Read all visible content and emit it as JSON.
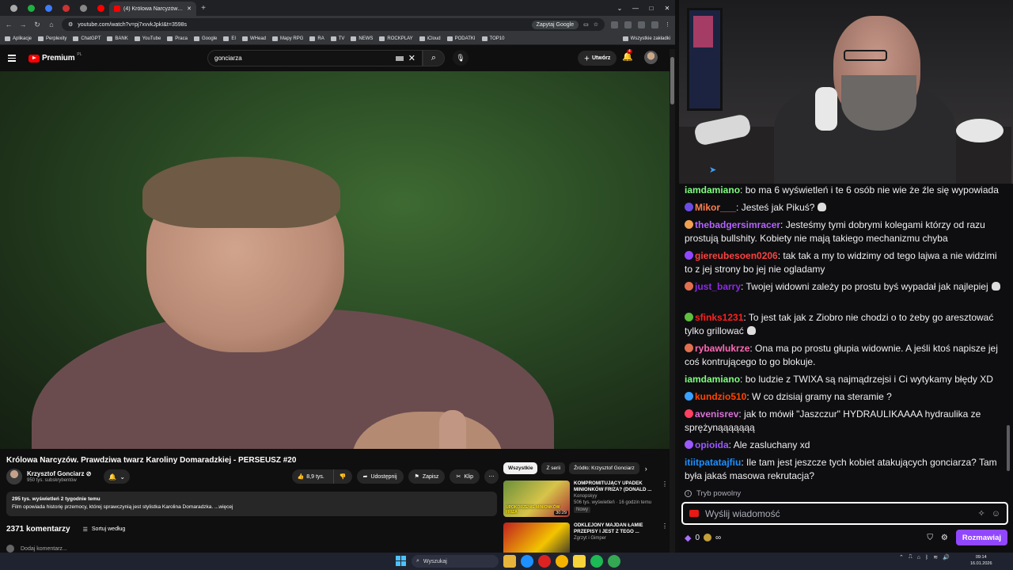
{
  "browser": {
    "active_tab_title": "(4) Królowa Narcyzów. Prawdziwa...",
    "new_tab": "+",
    "url": "youtube.com/watch?v=pj7xvvkJpkI&t=3598s",
    "ask_google": "Zapytaj Google",
    "bookmarks": [
      "Aplikacje",
      "Perplexity",
      "ChatGPT",
      "BANK",
      "YouTube",
      "Praca",
      "Google",
      "EI",
      "WHead",
      "Mapy RPG",
      "RA",
      "TV",
      "NEWS",
      "ROCKPLAY",
      "iCloud",
      "PODATKI",
      "TOP10"
    ],
    "bookmarks_right": "Wszystkie zakładki"
  },
  "youtube": {
    "brand": "Premium",
    "brand_cc": "PL",
    "search_value": "gonciarza",
    "create_label": "Utwórz",
    "notif_count": "4",
    "video_title": "Królowa Narcyzów. Prawdziwa twarz Karoliny Domaradzkiej - PERSEUSZ #20",
    "channel_name": "Krzysztof Gonciarz",
    "channel_verified": "⊘",
    "subscribers": "950 tys. subskrybentów",
    "likes": "8,9 tys.",
    "share": "Udostępnij",
    "save": "Zapisz",
    "clip": "Klip",
    "desc_stats": "295 tys. wyświetleń  2 tygodnie temu",
    "desc_text": "Film opowiada historię przemocy, której sprawczynią jest stylistka Karolina Domaradzka. ...więcej",
    "comments_count": "2371 komentarzy",
    "sort_label": "Sortuj według",
    "add_comment": "Dodaj komentarz...",
    "chips": [
      "Wszystkie",
      "Z serii",
      "Źródło: Krzysztof Gonciarz"
    ],
    "related": [
      {
        "title": "KOMPROMITUJĄCY UPADEK MINIONKÓW FRIZA? (DONALD ...",
        "channel": "Konopskyy",
        "meta": "506 tys. wyświetleń · 16 godzin temu",
        "badge": "Nowy",
        "duration": "30:29",
        "thumb_caption": "UPOKORZENIE MINIONKÓW FRIZA"
      },
      {
        "title": "ODKLEJONY MAJDAN ŁAMIE PRZEPISY I JEST Z TEGO ...",
        "channel": "Zgrzyt i Gimper",
        "meta": "",
        "badge": "",
        "duration": "",
        "thumb_caption": ""
      }
    ]
  },
  "chat": {
    "messages": [
      {
        "user": "iamdamiano",
        "color": "#7fff7f",
        "text": "bo ma 6 wyświetleń i te 6 osób nie wie że źle się wypowiada",
        "badge": "",
        "skull": false
      },
      {
        "user": "Mikor___",
        "color": "#ff7f50",
        "text": "Jesteś jak Pikuś?",
        "badge": "#6b4de6",
        "skull": true
      },
      {
        "user": "thebadgersimracer",
        "color": "#b463ff",
        "text": "Jesteśmy tymi dobrymi kolegami którzy od razu prostują bullshity. Kobiety nie mają takiego mechanizmu chyba",
        "badge": "#f0a050",
        "skull": false
      },
      {
        "user": "giereubesoen0206",
        "color": "#ff4040",
        "text": "tak tak a my to widzimy od tego lajwa a nie widzimi to z jej strony bo jej nie ogladamy",
        "badge": "#9147ff",
        "skull": false
      },
      {
        "user": "just_barry",
        "color": "#8a2be2",
        "text": "Twojej widowni zależy po prostu byś wypadał jak najlepiej",
        "badge": "#e07050",
        "skull": true
      },
      {
        "user": "sfinks1231",
        "color": "#ff2020",
        "text": "To jest tak jak z Ziobro nie chodzi o to żeby go aresztować tylko grillować",
        "badge": "#5fbf3f",
        "skull": true
      },
      {
        "user": "rybawlukrze",
        "color": "#ff69b4",
        "text": "Ona ma po prostu głupia widownie. A jeśli ktoś napisze jej coś kontrującego to go blokuje.",
        "badge": "#e07050",
        "skull": false
      },
      {
        "user": "iamdamiano",
        "color": "#7fff7f",
        "text": "bo ludzie z TWIXA są najmądrzejsi i Ci wytykamy błędy XD",
        "badge": "",
        "skull": false
      },
      {
        "user": "kundzio510",
        "color": "#ff4500",
        "text": "W co dzisiaj gramy na steramie ?",
        "badge": "#3aa1ff",
        "skull": false
      },
      {
        "user": "avenisrev",
        "color": "#da70d6",
        "text": "jak to mówił \"Jaszczur\" HYDRAULIKAAAA hydraulika ze sprężynąąąąąąą",
        "badge": "#ff4060",
        "skull": false
      },
      {
        "user": "opioida",
        "color": "#9b59ff",
        "text": "Ale zasluchany xd",
        "badge": "#9b59ff",
        "skull": false
      },
      {
        "user": "itiitpatatajfiu",
        "color": "#1e90ff",
        "text": "Ile tam jest jeszcze tych kobiet atakujących gonciarza? Tam była jakaś masowa rekrutacja?",
        "badge": "",
        "skull": false
      }
    ],
    "slow_mode": "Tryb powolny",
    "input_placeholder": "Wyślij wiadomość",
    "bits": "0",
    "points": "∞",
    "send_label": "Rozmawiaj"
  },
  "taskbar": {
    "search_placeholder": "Wyszukaj",
    "time": "09:14",
    "date": "16.01.2026"
  }
}
